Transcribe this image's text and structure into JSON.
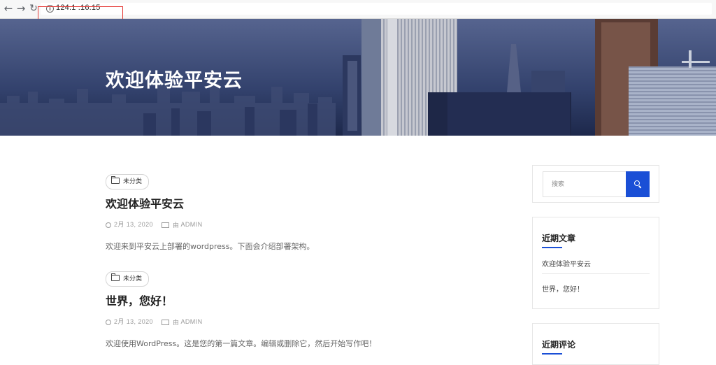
{
  "browser": {
    "back_icon": "arrow-left-icon",
    "forward_icon": "arrow-right-icon",
    "reload_icon": "reload-icon",
    "info_icon": "info-icon",
    "url": "124.1  .16.15"
  },
  "hero": {
    "title": "欢迎体验平安云"
  },
  "posts": [
    {
      "category": "未分类",
      "title": "欢迎体验平安云",
      "date": "2月 13, 2020",
      "author_prefix": "由",
      "author": "ADMIN",
      "excerpt": "欢迎来到平安云上部署的wordpress。下面会介绍部署架构。"
    },
    {
      "category": "未分类",
      "title": "世界，您好！",
      "date": "2月 13, 2020",
      "author_prefix": "由",
      "author": "ADMIN",
      "excerpt": "欢迎使用WordPress。这是您的第一篇文章。编辑或删除它，然后开始写作吧！"
    }
  ],
  "sidebar": {
    "search": {
      "placeholder": "搜索",
      "icon": "search-icon"
    },
    "recent_posts": {
      "title": "近期文章",
      "items": [
        "欢迎体验平安云",
        "世界，您好！"
      ]
    },
    "recent_comments": {
      "title": "近期评论"
    }
  },
  "colors": {
    "accent": "#1a4fd6",
    "hero_base": "#2d3b66",
    "annotation_box": "#e53935"
  }
}
